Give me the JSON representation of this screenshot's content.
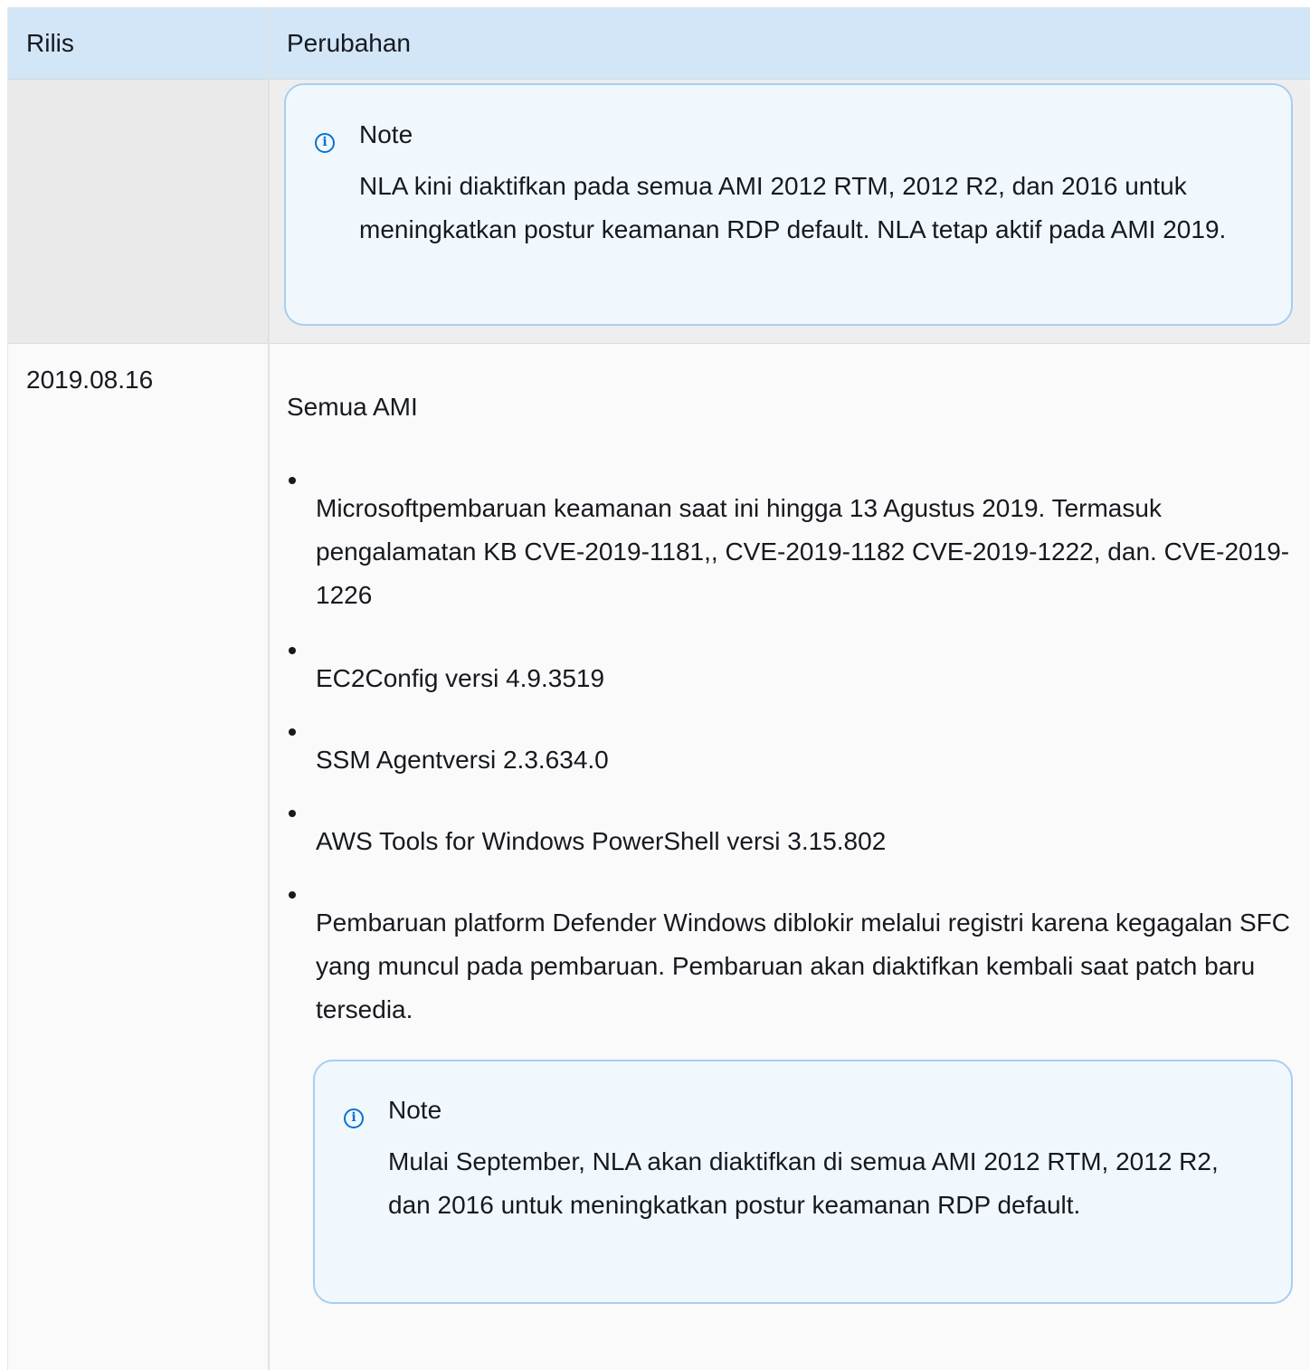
{
  "table": {
    "headers": {
      "release": "Rilis",
      "changes": "Perubahan"
    },
    "rows": [
      {
        "release": "",
        "note": {
          "title": "Note",
          "body": "NLA kini diaktifkan pada semua AMI 2012 RTM, 2012 R2, dan 2016 untuk meningkatkan postur keamanan RDP default. NLA tetap aktif pada AMI 2019."
        }
      },
      {
        "release": "2019.08.16",
        "section_title": "Semua AMI",
        "items": [
          "Microsoftpembaruan keamanan saat ini hingga 13 Agustus 2019. Termasuk pengalamatan KB CVE-2019-1181,, CVE-2019-1182 CVE-2019-1222, dan. CVE-2019-1226",
          "EC2Config versi 4.9.3519",
          "SSM Agentversi 2.3.634.0",
          "AWS Tools for Windows PowerShell versi 3.15.802",
          "Pembaruan platform Defender Windows diblokir melalui registri karena kegagalan SFC yang muncul pada pembaruan. Pembaruan akan diaktifkan kembali saat patch baru tersedia."
        ],
        "note": {
          "title": "Note",
          "body": "Mulai September, NLA akan diaktifkan di semua AMI 2012 RTM, 2012 R2, dan 2016 untuk meningkatkan postur keamanan RDP default."
        }
      }
    ]
  },
  "icons": {
    "info": "info-icon"
  },
  "colors": {
    "header_bg": "#d2e6f7",
    "note_border": "#a9cdf0",
    "note_bg": "#f1f8fd",
    "info_icon": "#0972d3"
  }
}
